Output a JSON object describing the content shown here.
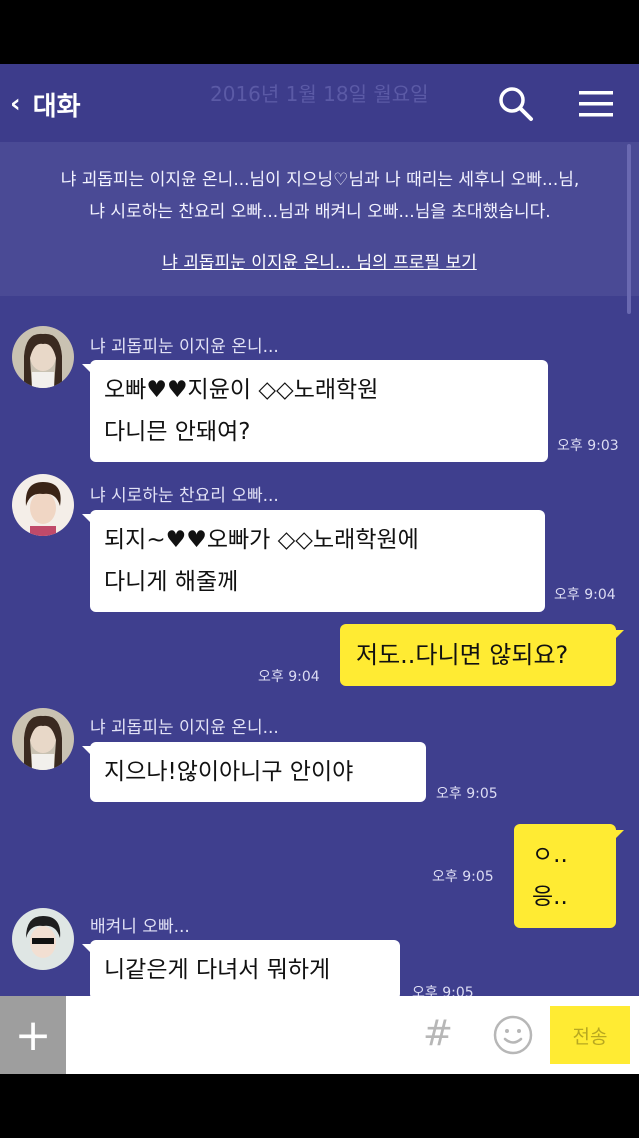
{
  "header": {
    "back_chevron": "‹",
    "title": "대화",
    "date_faded": "2016년 1월 18일 월요일",
    "icons": {
      "search": "search-icon",
      "menu": "menu-icon"
    }
  },
  "notice": {
    "text": "냐 괴돕피는 이지윤 온니...님이 지으닝♡님과 나 때리는 세후니 오빠...님, 냐 시로하는 찬요리 오빠...님과 배켜니 오빠...님을 초대했습니다.",
    "profile_link": "냐 괴돕피눈 이지윤 온니... 님의 프로필 보기"
  },
  "messages": [
    {
      "sender": "냐 괴돕피눈 이지윤 온니...",
      "line1": "오빠♥♥지윤이 ◇◇노래학원",
      "line2": "다니믄 안돼여?",
      "time": "오후 9:03"
    },
    {
      "sender": "냐 시로하눈 찬요리 오빠...",
      "line1": "되지~♥♥오빠가 ◇◇노래학원에",
      "line2": "다니게 해줄께",
      "time": "오후 9:04"
    },
    {
      "mine": true,
      "text": "저도..다니면 않되요?",
      "time": "오후 9:04"
    },
    {
      "sender": "냐 괴돕피눈 이지윤 온니...",
      "text": "지으나!않이아니구 안이야",
      "time": "오후 9:05"
    },
    {
      "mine": true,
      "text": "ㅇ..응..",
      "time": "오후 9:05"
    },
    {
      "sender": "배켜니 오빠...",
      "text": "니같은게 다녀서 뭐하게",
      "time": "오후 9:05"
    }
  ],
  "input": {
    "plus": "+",
    "placeholder": "",
    "hash": "#",
    "send": "전송"
  },
  "colors": {
    "background": "#3f3f8e",
    "my_bubble": "#ffeb33",
    "other_bubble": "#ffffff"
  }
}
